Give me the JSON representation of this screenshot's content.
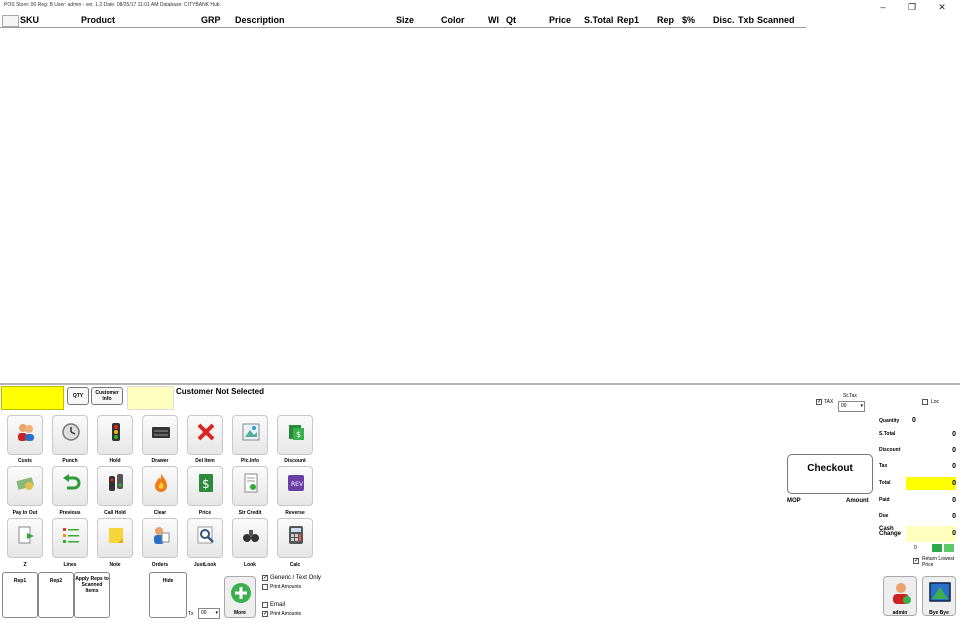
{
  "window": {
    "title": "POS Store: 00  Reg: B  User: admin -    ver. 1.2 Date: 08/25/17 11:01 AM  Database: CITYBANK Hub",
    "controls": [
      "‒",
      "❐",
      "✕"
    ]
  },
  "grid": {
    "columns": [
      "SKU",
      "Product",
      "GRP",
      "Description",
      "Size",
      "Color",
      "WI",
      "Qt",
      "Price",
      "S.Total",
      "Rep1",
      "Rep",
      "$%",
      "Disc.",
      "Txb",
      "Scanned"
    ]
  },
  "customer_row": {
    "qty_label": "QTY",
    "customer_info_label": "Customer Info",
    "customer_status": "Customer Not Selected"
  },
  "actions": [
    {
      "label": "Custs",
      "icon": "customers-icon"
    },
    {
      "label": "Punch",
      "icon": "clock-icon"
    },
    {
      "label": "Hold",
      "icon": "traffic-light-icon"
    },
    {
      "label": "Drawer",
      "icon": "cash-drawer-icon"
    },
    {
      "label": "Del Item",
      "icon": "delete-x-icon"
    },
    {
      "label": "Pic.Info",
      "icon": "picture-icon"
    },
    {
      "label": "Discount",
      "icon": "discount-icon"
    },
    {
      "label": "Pay In Out",
      "icon": "money-icon"
    },
    {
      "label": "Previous",
      "icon": "undo-arrow-icon"
    },
    {
      "label": "Call Hold",
      "icon": "traffic-light-call-icon"
    },
    {
      "label": "Clear",
      "icon": "fire-icon"
    },
    {
      "label": "Price",
      "icon": "dollar-icon"
    },
    {
      "label": "Str Credit",
      "icon": "document-icon"
    },
    {
      "label": "Reverse",
      "icon": "reverse-icon"
    },
    {
      "label": "Z",
      "icon": "z-report-icon"
    },
    {
      "label": "Lines",
      "icon": "list-lines-icon"
    },
    {
      "label": "Note",
      "icon": "note-icon"
    },
    {
      "label": "Orders",
      "icon": "orders-icon"
    },
    {
      "label": "JustLook",
      "icon": "magnifier-icon"
    },
    {
      "label": "Look",
      "icon": "binoculars-icon"
    },
    {
      "label": "Calc",
      "icon": "calculator-icon"
    }
  ],
  "reps": {
    "rep1": "Rep1",
    "rep2": "Rep2",
    "apply": "Apply Reps to Scanned Items",
    "hide": "Hide"
  },
  "tx": {
    "label": "Tx",
    "value": "00"
  },
  "more_label": "More",
  "options": {
    "generic_text_only": "Generic / Text Only",
    "print_amounts_1": "Print Amounts",
    "email": "Email",
    "print_amounts_2": "Print Amounts"
  },
  "right_panel": {
    "tax_label": "TAX",
    "sttax_label": "St.Tax",
    "sttax_value": "00",
    "loc_label": "Loc",
    "checkout_label": "Checkout",
    "mop_label": "MOP",
    "amount_label": "Amount",
    "quantity_label": "Quantity",
    "quantity_value": "0",
    "stotal_label": "S.Total",
    "stotal_value": "0",
    "discount_label": "Discount",
    "discount_value": "0",
    "tax_row_label": "Tax",
    "tax_row_value": "0",
    "total_label": "Total",
    "total_value": "0",
    "paid_label": "Paid",
    "paid_value": "0",
    "due_label": "Due",
    "due_value": "0",
    "cash_change_label": "Cash Change",
    "cash_change_value": "0",
    "small_count": "0",
    "return_lowest": "Return Lowest Price",
    "admin_label": "admin",
    "bye_label": "Bye Bye"
  },
  "colors": {
    "highlight_yellow": "#ffff00",
    "pale_yellow": "#ffffc0",
    "green": "#2ea84a"
  }
}
